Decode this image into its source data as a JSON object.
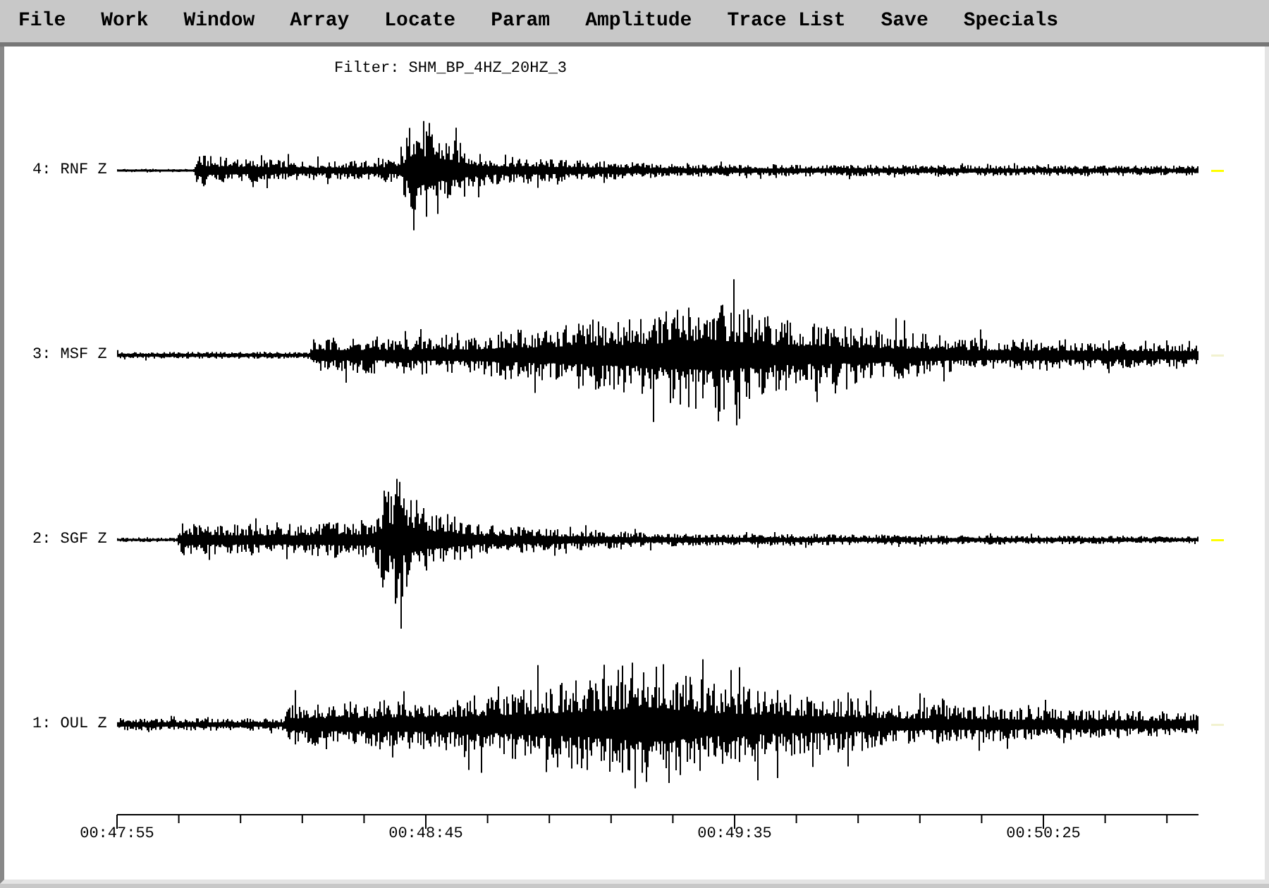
{
  "menu": [
    "File",
    "Work",
    "Window",
    "Array",
    "Locate",
    "Param",
    "Amplitude",
    "Trace List",
    "Save",
    "Specials"
  ],
  "filter": "Filter: SHM_BP_4HZ_20HZ_3",
  "traces": [
    {
      "label": "4: RNF Z",
      "color": "#ffff00"
    },
    {
      "label": "3: MSF Z",
      "color": "#f2f2d0"
    },
    {
      "label": "2: SGF Z",
      "color": "#ffff00"
    },
    {
      "label": "1: OUL Z",
      "color": "#f2f2d0"
    }
  ],
  "time_axis": {
    "labels": [
      "00:47:55",
      "00:48:45",
      "00:49:35",
      "00:50:25"
    ]
  }
}
